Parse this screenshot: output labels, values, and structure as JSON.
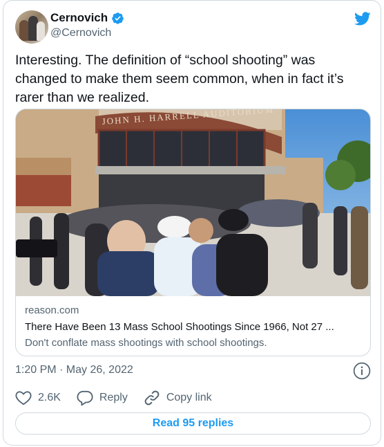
{
  "author": {
    "display_name": "Cernovich",
    "handle": "@Cernovich",
    "verified": true
  },
  "tweet": {
    "text": "Interesting. The definition of “school shooting” was changed to make them seem common, when in fact it’s rarer than we realized."
  },
  "card": {
    "image_sign_text": "JOHN H. HARRELL AUDITORIUM",
    "domain": "reason.com",
    "title": "There Have Been 13 Mass School Shootings Since 1966, Not 27 ...",
    "description": "Don't conflate mass shootings with school shootings."
  },
  "meta": {
    "timestamp": "1:20 PM · May 26, 2022"
  },
  "actions": {
    "likes": "2.6K",
    "reply_label": "Reply",
    "copy_link_label": "Copy link"
  },
  "replies_button": "Read 95 replies",
  "icons": {
    "brand": "twitter-bird-icon",
    "verified": "verified-badge-icon",
    "info": "info-icon",
    "like": "heart-icon",
    "reply": "speech-bubble-icon",
    "copy": "link-icon"
  },
  "colors": {
    "accent": "#1d9bf0",
    "secondary_text": "#536471",
    "border": "#cfd9de"
  }
}
